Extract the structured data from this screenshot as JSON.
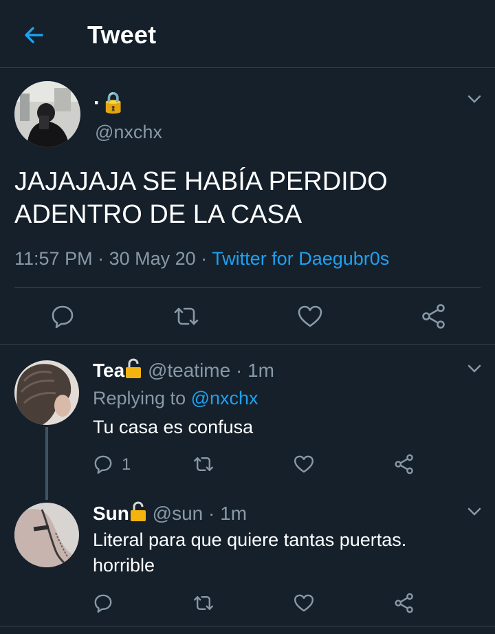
{
  "header": {
    "title": "Tweet",
    "back_icon": "arrow-left-icon"
  },
  "colors": {
    "background": "#15202b",
    "accent": "#1da1f2",
    "muted": "#8899a6",
    "divider": "#38444d",
    "lock_gold": "#f5b30f"
  },
  "main_tweet": {
    "display_name": "·🔒",
    "handle": "@nxchx",
    "text": "JAJAJAJA SE HABÍA PERDIDO ADENTRO DE LA CASA",
    "time": "11:57 PM",
    "date": "30 May 20",
    "separator": " · ",
    "source": "Twitter for Daegubr0s"
  },
  "replies": [
    {
      "display_name": "Tea",
      "handle": "@teatime",
      "time_ago": "· 1m",
      "replying_prefix": "Replying to",
      "replying_to": "@nxchx",
      "text": "Tu casa es confusa",
      "reply_count": "1"
    },
    {
      "display_name": "Sun",
      "handle": "@sun",
      "time_ago": "· 1m",
      "text": "Literal para que quiere tantas puertas. horrible"
    }
  ]
}
